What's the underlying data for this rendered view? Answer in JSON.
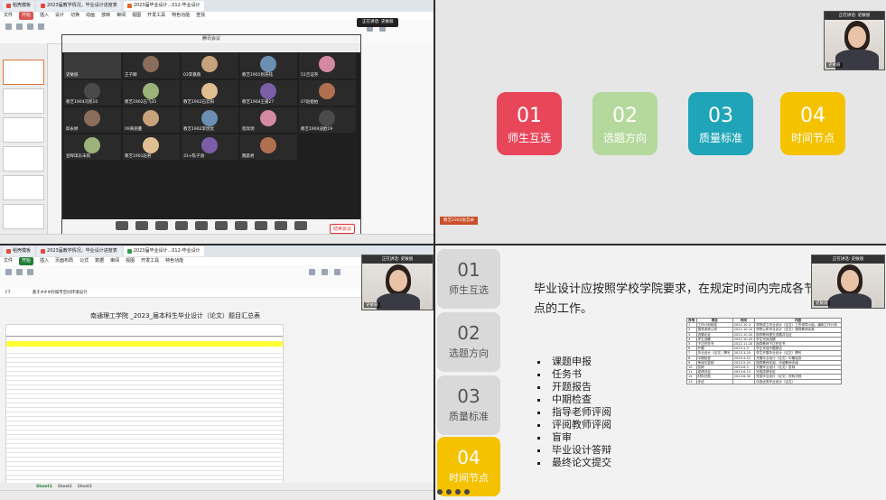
{
  "top_left": {
    "tabs": [
      "稻壳模板",
      "2023届教学情况，毕业设计进度表",
      "2023届毕业设计...012-毕业设计"
    ],
    "menu": [
      "文件",
      "开始",
      "插入",
      "设计",
      "切换",
      "动画",
      "放映",
      "审阅",
      "视图",
      "开发工具",
      "特色功能"
    ],
    "menu_search": "查找",
    "meeting": {
      "title": "腾讯会议",
      "participants": [
        "王子卿",
        "03李嘉薇",
        "教艺1901别浩钰",
        "51吉证券",
        "教艺1904冯凯10",
        "教艺1902石飞35",
        "教艺1902石云阳",
        "教艺1904王嘉27",
        "07赵姐柏",
        "邱永婷",
        "09黄丽蔓",
        "教艺1902李忧忧",
        "程玟玥",
        "教艺1904迪欧19",
        "宣晖琪东未雨",
        "教艺1901赵君",
        "31+陈子涵",
        "魏庭君"
      ],
      "speaker_label": "史敏丽",
      "leave": "结束会议"
    },
    "speaking_banner": "正在讲话: 史敏丽"
  },
  "top_right": {
    "speaking_banner": "正在讲话: 史敏丽",
    "cam_name": "史敏丽",
    "cards": [
      {
        "num": "01",
        "title": "师生互选",
        "color": "#e8475a"
      },
      {
        "num": "02",
        "title": "选题方向",
        "color": "#b5d99c"
      },
      {
        "num": "03",
        "title": "质量标准",
        "color": "#20a5b8"
      },
      {
        "num": "04",
        "title": "时间节点",
        "color": "#f5c200"
      }
    ],
    "speaker_tag": "教艺2302张哲卓"
  },
  "bottom_left": {
    "tabs": [
      "稻壳模板",
      "2023届教学情况，毕业设计进度表",
      "2023届毕业设计...012-毕业设计"
    ],
    "menu": [
      "文件",
      "开始",
      "插入",
      "页面布局",
      "公式",
      "数据",
      "审阅",
      "视图",
      "开发工具",
      "特色功能"
    ],
    "formula_bar": "基于###的城市空间环境设计",
    "cell_ref": "F7",
    "sheet_title": "南通理工学院 _2023_届本科生毕业设计（论文）题目汇总表",
    "sheets": [
      "Sheet1",
      "Sheet2",
      "Sheet3"
    ],
    "speaking_banner": "正在讲话: 史敏丽",
    "cam_name": "史敏丽"
  },
  "bottom_right": {
    "speaking_banner": "正在讲话: 史敏丽",
    "cam_name": "史敏丽",
    "side_cards": [
      {
        "num": "01",
        "title": "师生互选",
        "color": "#d9d9d9"
      },
      {
        "num": "02",
        "title": "选题方向",
        "color": "#d9d9d9"
      },
      {
        "num": "03",
        "title": "质量标准",
        "color": "#d9d9d9"
      },
      {
        "num": "04",
        "title": "时间节点",
        "color": "#f5c200"
      }
    ],
    "heading": "毕业设计应按照学校学院要求，在规定时间内完成各节点的工作。",
    "bullets": [
      "课题申报",
      "任务书",
      "开题报告",
      "中期检查",
      "指导老师评阅",
      "评阅教师评阅",
      "盲审",
      "毕业设计答辩",
      "最终论文提交"
    ],
    "table": {
      "headers": [
        "序号",
        "项目",
        "时间",
        "内容"
      ],
      "rows": [
        [
          "1",
          "工作计划制定",
          "2022.10.3",
          "学院成立毕业设计（论文）工作领导小组，编制工作计划"
        ],
        [
          "2",
          "指导老师公布",
          "2022.10.10",
          "学院公布毕业设计（论文）指导教师名单"
        ],
        [
          "3",
          "选题论证",
          "2022.10.20",
          "指导教师提交选题并论证"
        ],
        [
          "4",
          "学生选题",
          "2022.10.25",
          "学生完成选题"
        ],
        [
          "5",
          "下达任务书",
          "2022.11.20",
          "指导教师下达任务书"
        ],
        [
          "6",
          "开题",
          "2023.1.5",
          "学生完成开题报告"
        ],
        [
          "7",
          "毕业设计（论文）撰写",
          "2023.3.20",
          "学生开展毕业设计（论文）撰写"
        ],
        [
          "8",
          "中期检查",
          "2023.4.15",
          "开展毕业设计（论文）中期检查"
        ],
        [
          "9",
          "审阅与答辩",
          "2023.5.25",
          "指导教师评阅、评阅教师评阅"
        ],
        [
          "10",
          "答辩",
          "2023.6.5",
          "开展毕业设计（论文）答辩"
        ],
        [
          "11",
          "成绩评定",
          "2023.6.15",
          "完成成绩评定"
        ],
        [
          "12",
          "材料归档",
          "2023.6.30",
          "完成毕业设计（论文）材料归档"
        ],
        [
          "13",
          "评优",
          "",
          "评选优秀毕业设计（论文）"
        ]
      ]
    }
  }
}
